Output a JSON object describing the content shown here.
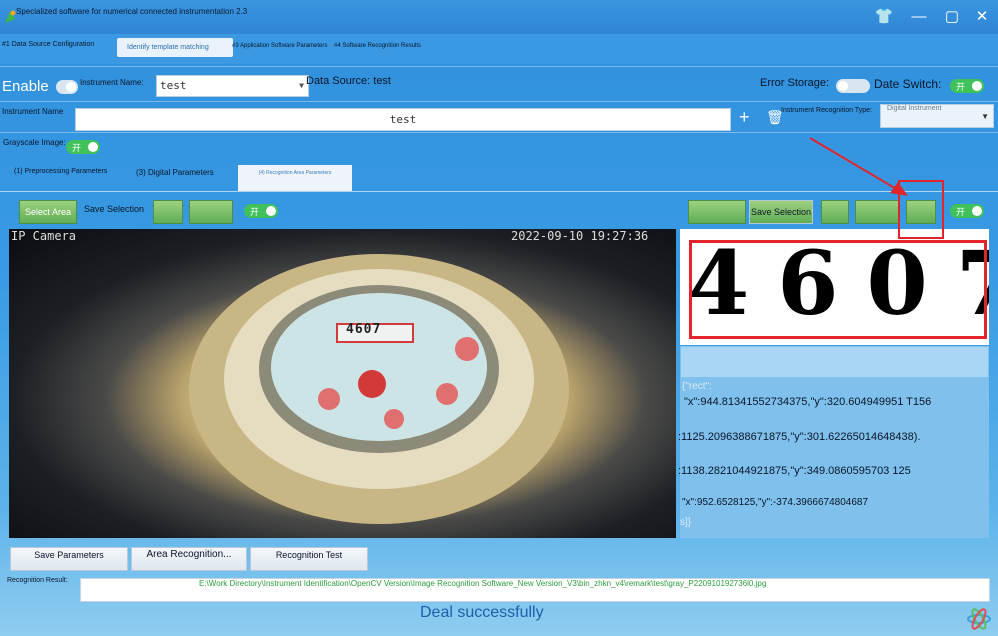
{
  "window": {
    "title": "Specialized software for numerical connected instrumentation 2.3"
  },
  "tabs": [
    {
      "label": "#1 Data Source Configuration"
    },
    {
      "label": "Identify template matching"
    },
    {
      "label": "#3 Application Software Parameters"
    },
    {
      "label": "#4 Software Recognition Results"
    }
  ],
  "row1": {
    "enable_label": "Enable",
    "instrument_name_label": "Instrument Name:",
    "instrument_name_value": "test",
    "data_source_label": "Data Source: test",
    "error_storage_label": "Error Storage:",
    "date_switch_label": "Date Switch:"
  },
  "row2": {
    "instrument_name_label": "Instrument Name",
    "instrument_name_value": "test",
    "recognition_type_label": "Instrument Recognition Type:",
    "recognition_type_value": "Digital Instrument"
  },
  "row3": {
    "grayscale_label": "Grayscale Image:"
  },
  "subtabs": [
    {
      "label": "(1) Preprocessing Parameters"
    },
    {
      "label": "(3) Digital Parameters"
    },
    {
      "label": "(4) Recognition Area Parameters"
    }
  ],
  "toolbar": {
    "select_area": "Select Area",
    "save_selection_left": "Save Selection",
    "save_selection_right": "Save Selection"
  },
  "toggles": {
    "on_mark": "开"
  },
  "camera": {
    "label": "IP Camera",
    "timestamp": "2022-09-10 19:27:36",
    "counter": "4607"
  },
  "digits": {
    "value": "4607"
  },
  "result_json": [
    "{\"rect\":",
    "\"x\":944.81341552734375,\"y\":320.604949951 T156",
    ":1125.2096388671875,\"y\":301.62265014648438).",
    ":1138.2821044921875,\"y\":349.0860595703 125",
    "\"x\":952.6528125,\"y\":-374.3966674804687",
    "s]}"
  ],
  "bottom": {
    "save_parameters": "Save Parameters",
    "area_recognition": "Area Recognition...",
    "recognition_test": "Recognition Test",
    "recognition_result_label": "Recognition Result:",
    "recognition_result_path": "E:\\Work Directory\\Instrument Identification\\OpenCV Version\\Image Recognition Software_New Version_V3\\bin_zhkn_v4\\remark\\test\\gray_P220910192736l0.jpg",
    "status": "Deal successfully"
  },
  "colors": {
    "accent_green": "#5fae55",
    "toggle_green": "#3fc25a",
    "highlight_red": "#e2252c",
    "status_blue": "#1f5fa8"
  }
}
